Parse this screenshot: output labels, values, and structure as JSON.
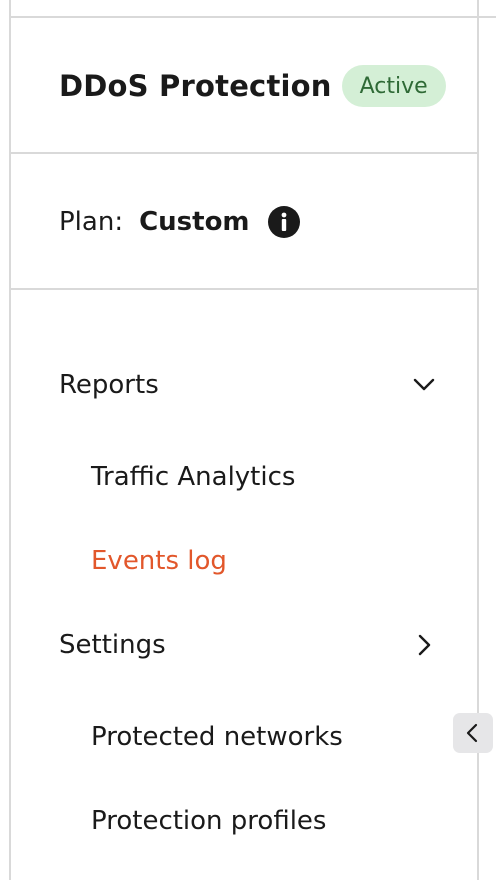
{
  "header": {
    "title": "DDoS Protection",
    "status_badge": "Active"
  },
  "plan": {
    "label": "Plan:",
    "value": "Custom"
  },
  "nav": {
    "reports": {
      "label": "Reports",
      "expanded": true,
      "items": [
        {
          "label": "Traffic Analytics",
          "active": false
        },
        {
          "label": "Events log",
          "active": true
        }
      ]
    },
    "settings": {
      "label": "Settings",
      "expanded": false,
      "items": [
        {
          "label": "Protected networks",
          "active": false
        },
        {
          "label": "Protection profiles",
          "active": false
        }
      ]
    }
  },
  "icons": {
    "info": "info-icon",
    "reports_toggle": "chevron-down-icon",
    "settings_toggle": "chevron-right-icon",
    "collapse": "chevron-left-icon"
  },
  "colors": {
    "active_link": "#e2572b",
    "badge_bg": "#d4efd6",
    "badge_text": "#2f6a36",
    "divider": "#d9d9d9"
  }
}
